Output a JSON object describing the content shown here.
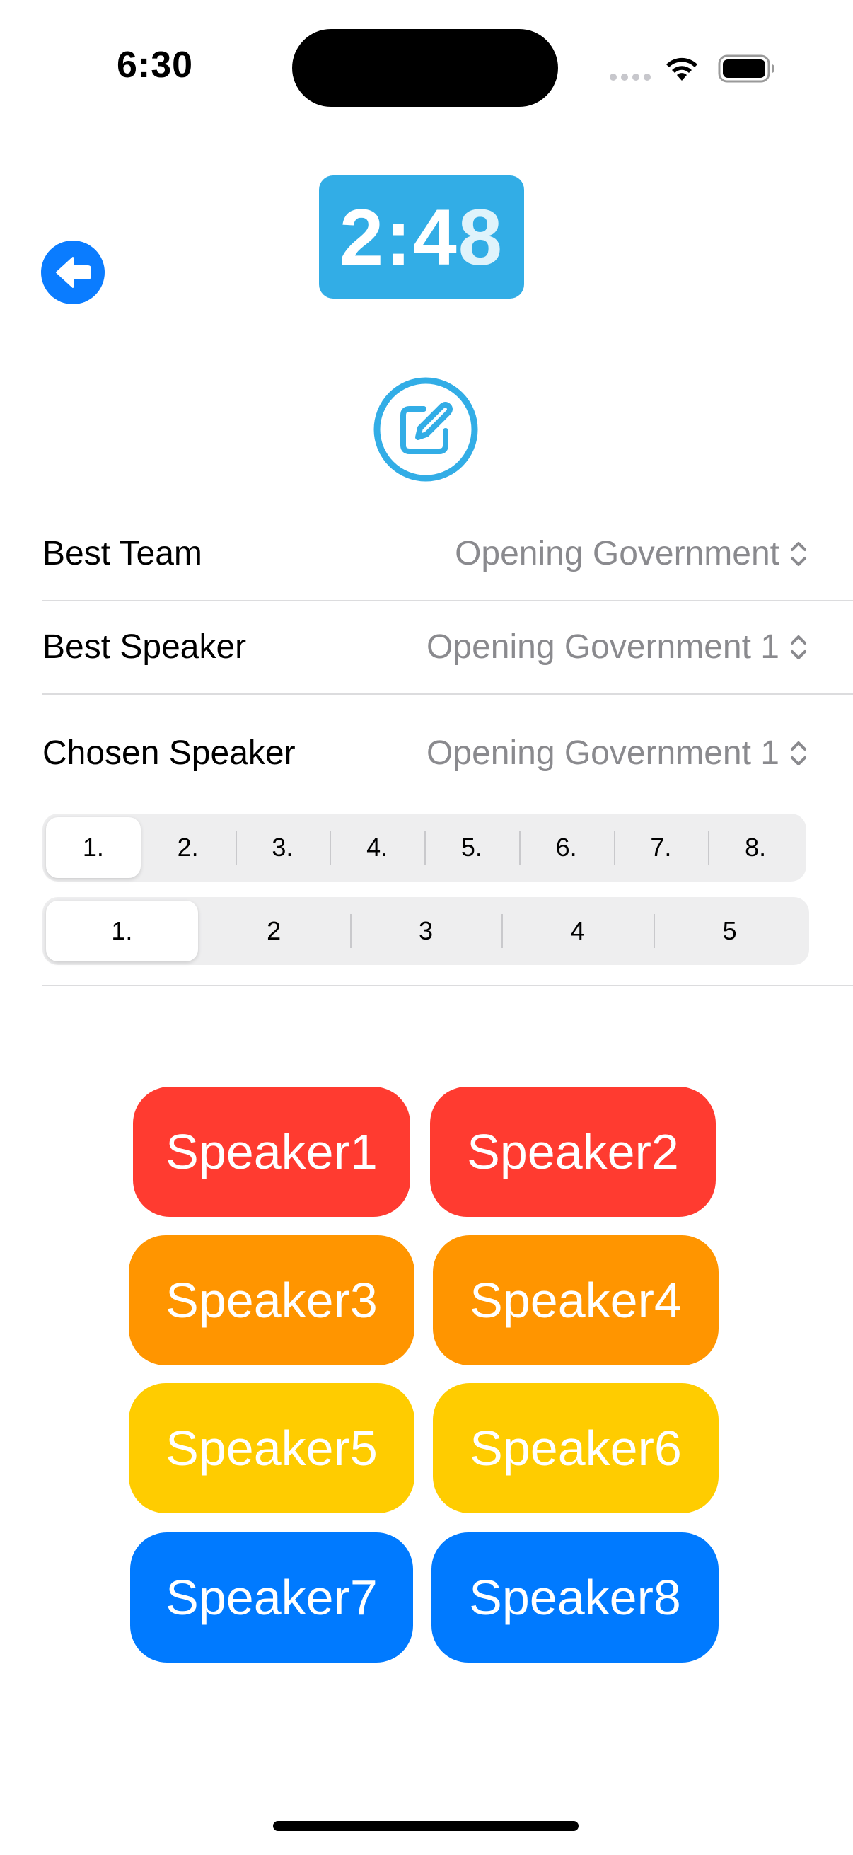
{
  "status_bar": {
    "time": "6:30"
  },
  "timer": {
    "main": "2:4",
    "faint": "8"
  },
  "icons": {
    "back": "arrow-left-circle-icon",
    "edit": "square-and-pencil-icon"
  },
  "colors": {
    "timer_bg": "#32ade6",
    "back_button": "#0a7cff",
    "speaker_red": "#ff3b30",
    "speaker_orange": "#ff9500",
    "speaker_yellow": "#ffcc00",
    "speaker_blue": "#007aff"
  },
  "form": {
    "best_team": {
      "label": "Best Team",
      "value": "Opening Government"
    },
    "best_speaker": {
      "label": "Best Speaker",
      "value": "Opening Government 1"
    },
    "chosen_speaker": {
      "label": "Chosen Speaker",
      "value": "Opening Government 1"
    }
  },
  "segment_speaker": {
    "options": [
      "1.",
      "2.",
      "3.",
      "4.",
      "5.",
      "6.",
      "7.",
      "8."
    ],
    "selected": "1."
  },
  "segment_score": {
    "options": [
      "1.",
      "2",
      "3",
      "4",
      "5"
    ],
    "selected": "1."
  },
  "speakers": [
    {
      "label": "Speaker1",
      "color": "#ff3b30"
    },
    {
      "label": "Speaker2",
      "color": "#ff3b30"
    },
    {
      "label": "Speaker3",
      "color": "#ff9500"
    },
    {
      "label": "Speaker4",
      "color": "#ff9500"
    },
    {
      "label": "Speaker5",
      "color": "#ffcc00"
    },
    {
      "label": "Speaker6",
      "color": "#ffcc00"
    },
    {
      "label": "Speaker7",
      "color": "#007aff"
    },
    {
      "label": "Speaker8",
      "color": "#007aff"
    }
  ]
}
